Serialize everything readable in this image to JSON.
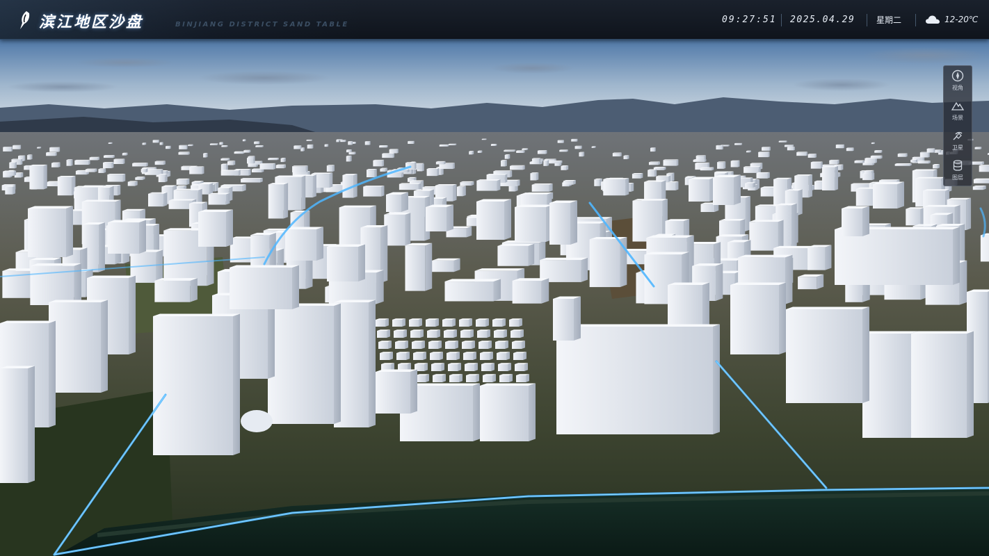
{
  "header": {
    "title": "滨江地区沙盘",
    "subtitle": "BINJIANG DISTRICT SAND TABLE",
    "time": "09:27:51",
    "date": "2025.04.29",
    "weekday": "星期二",
    "weather_icon": "cloud-icon",
    "temperature": "12-20℃"
  },
  "toolbar": {
    "items": [
      {
        "label": "视角",
        "icon": "compass-icon"
      },
      {
        "label": "场景",
        "icon": "mountain-icon"
      },
      {
        "label": "卫星",
        "icon": "satellite-icon"
      },
      {
        "label": "图层",
        "icon": "database-icon"
      }
    ]
  },
  "colors": {
    "accent_line": "#4fb6ff",
    "header_bg": "#131922",
    "building": "#dde3ec"
  }
}
